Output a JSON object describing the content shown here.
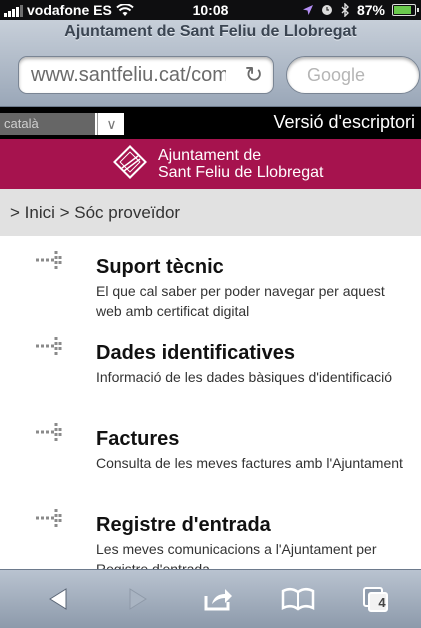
{
  "status": {
    "carrier": "vodafone ES",
    "time": "10:08",
    "battery": "87%",
    "battery_level": 0.87
  },
  "browser": {
    "page_title": "Ajuntament de Sant Feliu de Llobregat",
    "url": "www.santfeliu.cat/comm",
    "search_placeholder": "Google"
  },
  "langbar": {
    "selected_language": "català",
    "desktop_link": "Versió d'escriptori"
  },
  "brand": {
    "line1": "Ajuntament de",
    "line2": "Sant Feliu de Llobregat"
  },
  "breadcrumb": "> Inici > Sóc proveïdor",
  "items": [
    {
      "title": "Suport tècnic",
      "description": "El que cal saber per poder navegar per aquest web amb certificat digital"
    },
    {
      "title": "Dades identificatives",
      "description": "Informació de les dades bàsiques d'identificació"
    },
    {
      "title": "Factures",
      "description": "Consulta de les meves factures amb l'Ajuntament"
    },
    {
      "title": "Registre d'entrada",
      "description": "Les meves comunicacions a l'Ajuntament per Registre d'entrada"
    }
  ],
  "toolbar": {
    "tabs_count": "4"
  },
  "colors": {
    "brand": "#a6134e",
    "langbar": "#000000",
    "breadcrumb_bg": "#e1e1e1"
  }
}
